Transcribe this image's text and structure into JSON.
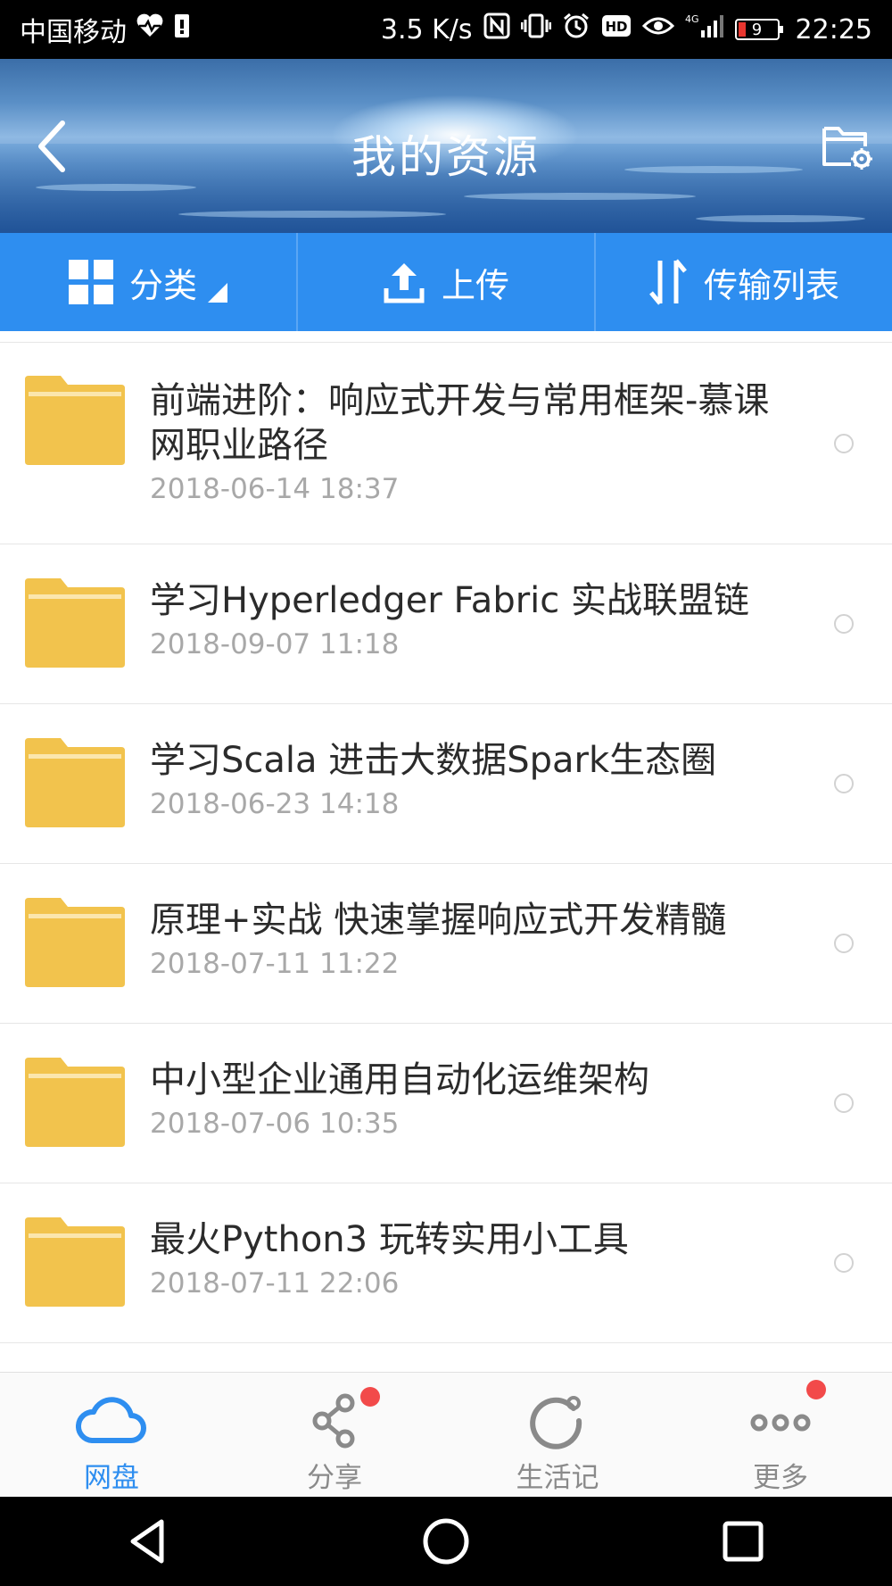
{
  "status_bar": {
    "carrier": "中国移动",
    "speed": "3.5 K/s",
    "battery": "9",
    "time": "22:25",
    "icons": [
      "heart-pulse-icon",
      "sim-icon",
      "nfc-icon",
      "vibrate-icon",
      "alarm-icon",
      "hd-icon",
      "eye-icon",
      "signal-4g-icon",
      "battery-icon"
    ]
  },
  "header": {
    "title": "我的资源",
    "back_icon": "chevron-left-icon",
    "right_icon": "folder-settings-icon"
  },
  "toolbar": {
    "category_label": "分类",
    "upload_label": "上传",
    "transfer_label": "传输列表"
  },
  "files": [
    {
      "name": "前端进阶：响应式开发与常用框架-慕课网职业路径",
      "date": "2018-06-14  18:37"
    },
    {
      "name": "学习Hyperledger Fabric 实战联盟链",
      "date": "2018-09-07  11:18"
    },
    {
      "name": "学习Scala 进击大数据Spark生态圈",
      "date": "2018-06-23  14:18"
    },
    {
      "name": "原理+实战 快速掌握响应式开发精髓",
      "date": "2018-07-11  11:22"
    },
    {
      "name": "中小型企业通用自动化运维架构",
      "date": "2018-07-06  10:35"
    },
    {
      "name": "最火Python3 玩转实用小工具",
      "date": "2018-07-11  22:06"
    }
  ],
  "bottom_nav": [
    {
      "label": "网盘",
      "icon": "cloud-icon",
      "active": true,
      "badge": false
    },
    {
      "label": "分享",
      "icon": "share-icon",
      "active": false,
      "badge": true
    },
    {
      "label": "生活记",
      "icon": "refresh-circle-icon",
      "active": false,
      "badge": false
    },
    {
      "label": "更多",
      "icon": "more-dots-icon",
      "active": false,
      "badge": true
    }
  ],
  "colors": {
    "primary": "#2e8ef0",
    "folder": "#f2c34d",
    "badge": "#f24a4a"
  }
}
